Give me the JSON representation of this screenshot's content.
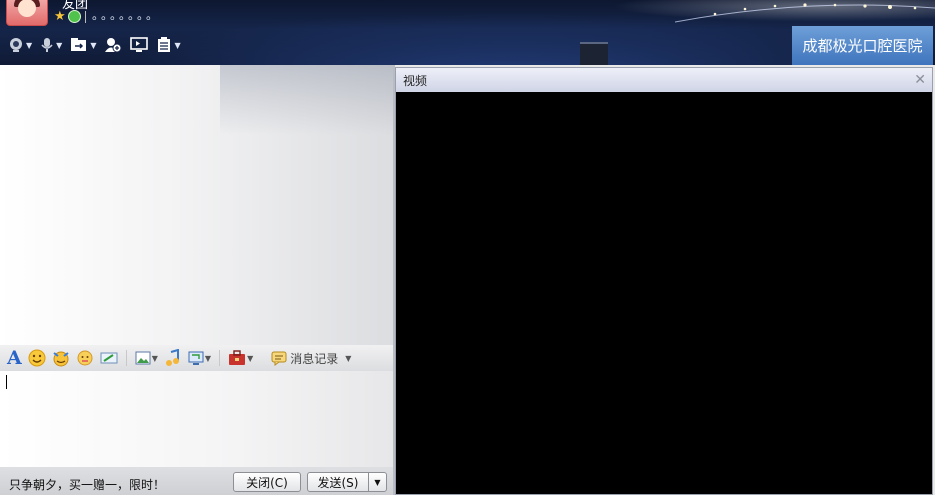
{
  "header": {
    "name": "友团",
    "signature": "。。。。。。。",
    "hospital_name": "成都极光口腔医院",
    "toolbar_icons": [
      "camera-icon",
      "microphone-icon",
      "file-transfer-icon",
      "add-contact-icon",
      "remote-desktop-icon",
      "app-menu-icon"
    ]
  },
  "input_toolbar": {
    "font_icon": "A",
    "history_label": "消息记录"
  },
  "bottom": {
    "ad_text": "只争朝夕，买一赠一，限时！",
    "close_label": "关闭(C)",
    "send_label": "发送(S)"
  },
  "video": {
    "title": "视频"
  },
  "colors": {
    "header_bg": "#15254a",
    "hospital_bg": "#4f83c7",
    "video_bg": "#000000"
  }
}
